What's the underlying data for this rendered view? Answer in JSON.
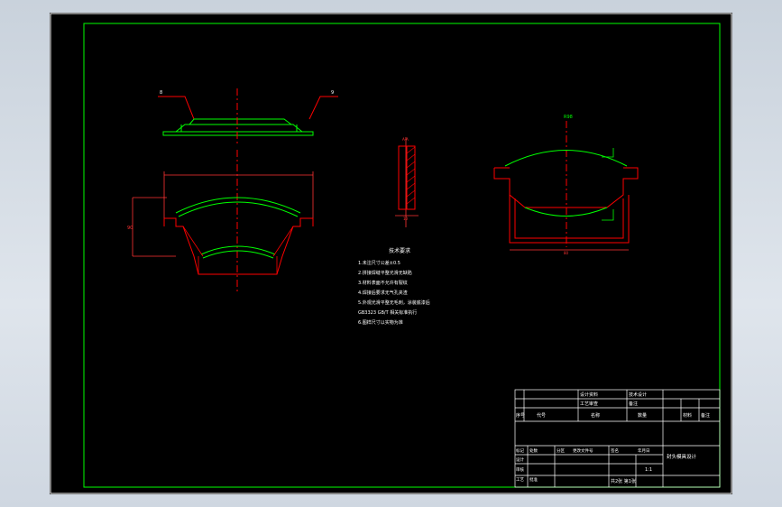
{
  "drawing": {
    "notes": {
      "title": "技术要求",
      "lines": [
        "1.未注尺寸公差±0.5",
        "2.拼接焊缝平整光滑无缺陷",
        "3.材料表面不允许有裂纹",
        "4.焊接后要求无气孔夹渣",
        "5.外观光滑平整无毛刺，涂装底漆后",
        "GB3323 GB/T 相关标准执行",
        "6.图样尺寸以实物为准"
      ]
    },
    "title_block": {
      "drawing_name": "封头模具设计",
      "scale": "1:1",
      "sheet": "共2张 第1张",
      "rows_top": [
        "设计资料",
        "技术设计",
        "工艺审查",
        "备注"
      ],
      "labels": [
        "标记",
        "处数",
        "分区",
        "更改文件号",
        "签名",
        "年月日"
      ],
      "roles": [
        "设计",
        "审核",
        "工艺",
        "批准"
      ],
      "header_cols": [
        "序号",
        "代号",
        "名称",
        "数量",
        "材料",
        "备注"
      ]
    },
    "colors": {
      "background": "#000000",
      "frame": "#00ff00",
      "outline": "#ff0000",
      "curve": "#00ff00",
      "text": "#ffffff",
      "dim": "#ff3333",
      "center": "#ff0000"
    }
  }
}
